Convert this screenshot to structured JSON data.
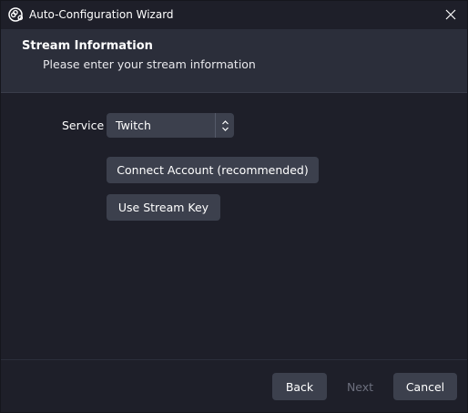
{
  "window": {
    "title": "Auto-Configuration Wizard"
  },
  "header": {
    "title": "Stream Information",
    "subtitle": "Please enter your stream information"
  },
  "form": {
    "service_label": "Service",
    "service_value": "Twitch",
    "connect_account_label": "Connect Account (recommended)",
    "use_stream_key_label": "Use Stream Key"
  },
  "footer": {
    "back_label": "Back",
    "next_label": "Next",
    "cancel_label": "Cancel"
  },
  "icons": {
    "app": "obs-logo-icon",
    "close": "close-icon",
    "select": "updown-arrows-icon"
  },
  "colors": {
    "background": "#1e1f29",
    "header_background": "#2b2e3a",
    "button_background": "#3c404d",
    "disabled_text": "#6c6f7d"
  }
}
